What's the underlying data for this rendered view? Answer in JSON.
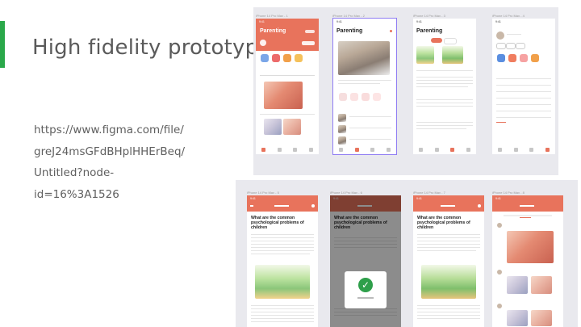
{
  "slide": {
    "title": "High fidelity prototype",
    "link_text": "https://www.figma.com/file/\ngreJ24msGFdBHplHHErBeq/\nUntitled?node-\nid=16%3A1526",
    "accent_color": "#2aa84a"
  },
  "colors": {
    "brand": "#e8735c",
    "selection": "#8f7cf3",
    "canvas": "#e9e9ee",
    "success": "#2e9f4a"
  },
  "frames_top": [
    {
      "label": "iPhone 14 Pro Max - 1",
      "title": "Parenting"
    },
    {
      "label": "iPhone 14 Pro Max - 2",
      "title": "Parenting"
    },
    {
      "label": "iPhone 14 Pro Max - 3",
      "title": "Parenting"
    },
    {
      "label": "iPhone 14 Pro Max - 4",
      "title": ""
    }
  ],
  "frames_bottom": [
    {
      "label": "iPhone 14 Pro Max - 5"
    },
    {
      "label": "iPhone 14 Pro Max - 6"
    },
    {
      "label": "iPhone 14 Pro Max - 7"
    },
    {
      "label": "iPhone 14 Pro Max - 8"
    }
  ],
  "article": {
    "heading": "What are the common psychological problems of children"
  },
  "icons": [
    "heart-icon",
    "doctor-icon",
    "shop-icon",
    "community-icon",
    "check-icon",
    "home-icon"
  ]
}
